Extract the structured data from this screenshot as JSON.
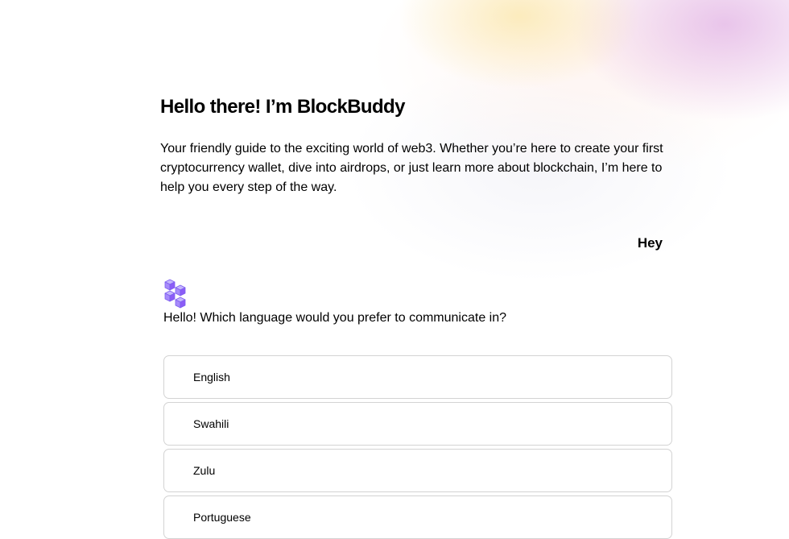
{
  "header": {
    "title": "Hello there! I’m BlockBuddy",
    "intro": "Your friendly guide to the exciting world of web3. Whether you’re here to create your first cryptocurrency wallet, dive into airdrops, or just learn more about blockchain, I’m here to help you every step of the way."
  },
  "chat": {
    "user_message": "Hey",
    "bot_avatar_icon": "blocks-cube-icon",
    "bot_message": "Hello! Which language would you prefer to communicate in?",
    "options": [
      {
        "label": "English"
      },
      {
        "label": "Swahili"
      },
      {
        "label": "Zulu"
      },
      {
        "label": "Portuguese"
      }
    ]
  },
  "colors": {
    "avatar": "#a78bfa",
    "option_border": "#d3d3d3"
  }
}
